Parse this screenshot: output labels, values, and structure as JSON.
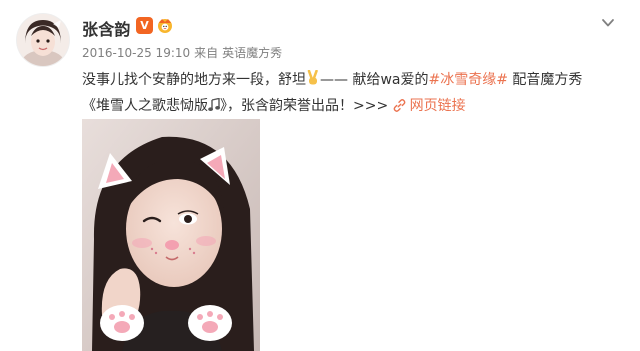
{
  "post": {
    "author": {
      "name": "张含韵",
      "verified_badge": "V",
      "crown_icon": "crown-badge-icon",
      "avatar_icon": "avatar-portrait"
    },
    "meta": {
      "datetime": "2016-10-25 19:10",
      "source_prefix": "来自",
      "source": "英语魔方秀"
    },
    "text": {
      "line1_a": "没事儿找个安静的地方来一段，舒坦",
      "line1_b": "—— 献给wa爱的",
      "hashtag": "#冰雪奇缘#",
      "line1_c": " 配音魔方秀",
      "line2_a": "《堆雪人之歌悲恸版",
      "line2_b": "》，张含韵荣誉出品！>>> ",
      "link_label": "网页链接"
    },
    "icons": {
      "victory": "victory-hand-icon",
      "music": "music-note-icon",
      "link": "link-icon",
      "menu": "chevron-down-icon"
    },
    "colors": {
      "accent": "#eb7350",
      "verified": "#f26522",
      "text": "#333333",
      "meta": "#808080",
      "background": "#ffffff"
    }
  }
}
